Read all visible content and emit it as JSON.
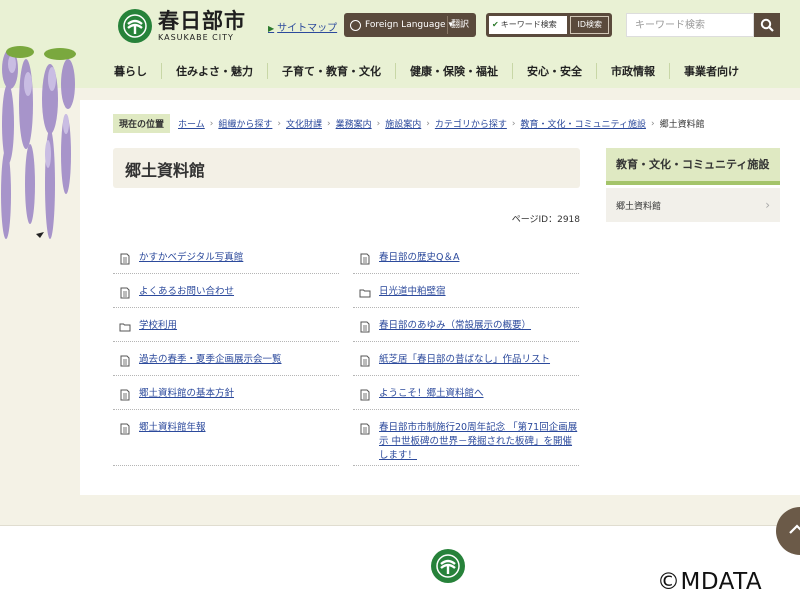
{
  "header": {
    "logo_name": "春日部市",
    "logo_sub": "KASUKABE CITY",
    "sitemap": "サイトマップ",
    "foreign_language": "Foreign Language ▾",
    "translate": "翻訳",
    "keyword_search": "キーワード検索",
    "id_search": "ID検索",
    "search_placeholder": "キーワード検索"
  },
  "nav": [
    "暮らし",
    "住みよさ・魅力",
    "子育て・教育・文化",
    "健康・保険・福祉",
    "安心・安全",
    "市政情報",
    "事業者向け"
  ],
  "breadcrumb": {
    "label": "現在の位置",
    "items": [
      "ホーム",
      "組織から探す",
      "文化財課",
      "業務案内",
      "施設案内",
      "カテゴリから探す",
      "教育・文化・コミュニティ施設"
    ],
    "current": "郷土資料館"
  },
  "main": {
    "title": "郷土資料館",
    "page_id": "ページID：2918",
    "left_items": [
      {
        "label": "かすかべデジタル写真館",
        "icon": "document-icon"
      },
      {
        "label": "よくあるお問い合わせ",
        "icon": "document-icon"
      },
      {
        "label": "学校利用",
        "icon": "folder-icon"
      },
      {
        "label": "過去の春季・夏季企画展示会一覧",
        "icon": "document-icon"
      },
      {
        "label": "郷土資料館の基本方針",
        "icon": "document-icon"
      },
      {
        "label": "郷土資料館年報",
        "icon": "document-icon"
      }
    ],
    "right_items": [
      {
        "label": "春日部の歴史Q＆A",
        "icon": "document-icon"
      },
      {
        "label": "日光道中粕壁宿",
        "icon": "folder-icon"
      },
      {
        "label": "春日部のあゆみ（常設展示の概要）",
        "icon": "document-icon"
      },
      {
        "label": "紙芝居「春日部の昔ばなし」作品リスト",
        "icon": "document-icon"
      },
      {
        "label": "ようこそ！郷土資料館へ",
        "icon": "document-icon"
      },
      {
        "label": "春日部市市制施行20周年記念 「第71回企画展示 中世板碑の世界－発掘された板碑」を開催します！",
        "icon": "document-icon"
      }
    ]
  },
  "side": {
    "heading": "教育・文化・コミュニティ施設",
    "items": [
      "郷土資料館"
    ]
  },
  "watermark": "©MDATA",
  "colors": {
    "brand_green": "#27823a",
    "header_bg": "#e9f1d4",
    "brown": "#5a4a3c",
    "link": "#2c4a9c"
  }
}
